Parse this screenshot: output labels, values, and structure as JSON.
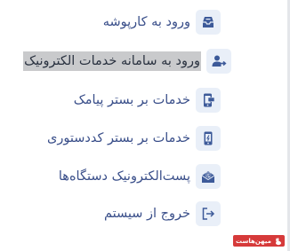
{
  "menu": {
    "items": [
      {
        "label": "ورود به کارپوشه",
        "icon": "inbox-tray-icon"
      },
      {
        "label": "ورود به سامانه خدمات الکترونیک",
        "icon": "user-login-icon"
      },
      {
        "label": "خدمات بر بستر پیامک",
        "icon": "mobile-sms-icon"
      },
      {
        "label": "خدمات بر بستر کددستوری",
        "icon": "mobile-ussd-icon"
      },
      {
        "label": "پست‌الکترونیک دستگاه‌ها",
        "icon": "email-at-icon"
      },
      {
        "label": "خروج از سیستم",
        "icon": "logout-icon"
      }
    ],
    "active_index": 1
  },
  "badge": {
    "text": "میهن‌هاست",
    "icon": "rabbit-logo-icon"
  },
  "colors": {
    "text": "#3a4f8a",
    "icon": "#3d5a99",
    "icon_bg": "#e9eff8",
    "active_bg": "#c9cacc",
    "badge_bg": "#d63a3a"
  }
}
